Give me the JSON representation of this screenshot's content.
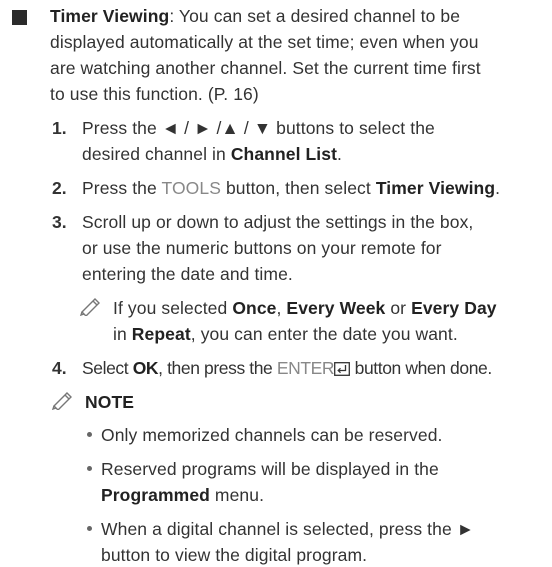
{
  "timer": {
    "title": "Timer Viewing",
    "l1": ": You can set a desired channel to be",
    "l2": "displayed automatically at the set time; even when you",
    "l3": "are watching another channel. Set the current time first",
    "l4": "to use this function. (P. 16)"
  },
  "steps": {
    "s1_num": "1.",
    "s1_l1": "Press the ◄ / ► /▲ / ▼ buttons to select the",
    "s1_l2a": "desired channel in ",
    "s1_l2b": "Channel List",
    "s1_l2c": ".",
    "s2_num": "2.",
    "s2_a": "Press the ",
    "s2_b": "TOOLS",
    "s2_c": " button, then select ",
    "s2_d": "Timer Viewing",
    "s2_e": ".",
    "s3_num": "3.",
    "s3_l1": "Scroll up or down to adjust the settings in the box,",
    "s3_l2": "or use the numeric buttons on your remote for",
    "s3_l3": "entering the date and time.",
    "note_a": "If you selected ",
    "note_b": "Once",
    "note_c": ", ",
    "note_d": "Every Week",
    "note_e": " or ",
    "note_f": "Every Day",
    "note_g": "in ",
    "note_h": "Repeat",
    "note_i": ", you can enter the date you want.",
    "s4_num": "4.",
    "s4_a": "Select ",
    "s4_b": "OK",
    "s4_c": ", then press the ",
    "s4_d": "ENTER",
    "s4_e": " button when done."
  },
  "notes": {
    "heading": "NOTE",
    "b1": "Only memorized channels can be reserved.",
    "b2_l1": "Reserved programs will be displayed in the",
    "b2_l2a": "Programmed",
    "b2_l2b": " menu.",
    "b3_l1": "When a digital channel is selected, press the ►",
    "b3_l2": "button to view the digital program."
  }
}
